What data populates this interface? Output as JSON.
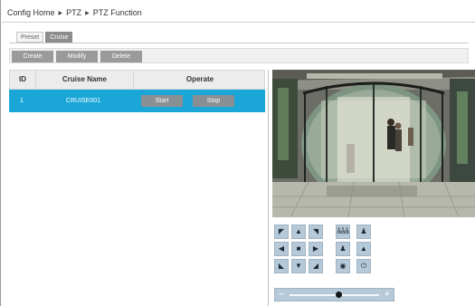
{
  "breadcrumb": {
    "home": "Config Home",
    "section": "PTZ",
    "page": "PTZ Function"
  },
  "tabs": [
    {
      "label": "Preset"
    },
    {
      "label": "Cruise"
    }
  ],
  "active_tab": "Cruise",
  "toolbar": {
    "create": "Create",
    "modify": "Modify",
    "delete": "Delete"
  },
  "table": {
    "headers": {
      "id": "ID",
      "name": "Cruise Name",
      "operate": "Operate"
    },
    "rows": [
      {
        "id": "1",
        "name": "CRUISE001",
        "start": "Start",
        "stop": "Stop"
      }
    ]
  },
  "ptz": {
    "buttons": [
      [
        "arrow-up-left-icon",
        "arrow-up-icon",
        "arrow-up-right-icon",
        "people-icon",
        "zoom-in-person-icon"
      ],
      [
        "arrow-left-icon",
        "stop-icon",
        "arrow-right-icon",
        "person-icon",
        "mountain-icon"
      ],
      [
        "arrow-down-left-icon",
        "arrow-down-icon",
        "arrow-down-right-icon",
        "focus-icon",
        "power-icon"
      ]
    ],
    "zoom": {
      "minus": "−",
      "plus": "+",
      "level": 0.55
    }
  },
  "colors": {
    "selected_row": "#1aa7d8",
    "button_gray": "#9a9a9a",
    "ptz_button": "#b6c9d8"
  }
}
